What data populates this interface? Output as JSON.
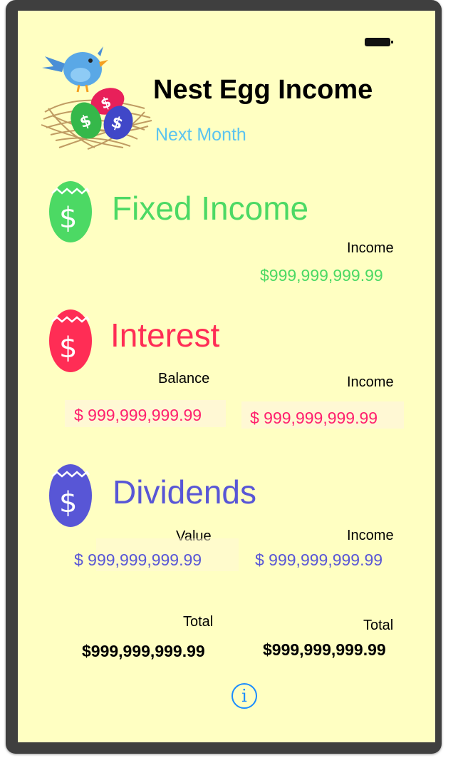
{
  "header": {
    "title": "Nest Egg Income",
    "subtitle": "Next Month"
  },
  "status_bar": {
    "battery_icon": "battery-icon"
  },
  "colors": {
    "screen_bg": "#ffffc2",
    "fixed_income": "#4cd964",
    "interest": "#ff2d55",
    "dividends": "#5856d6",
    "subtitle": "#5bc4f0",
    "info": "#1a8cff"
  },
  "fixed_income": {
    "title": "Fixed Income",
    "icon": "dollar-egg-icon",
    "income_label": "Income",
    "income_value": "$999,999,999.99"
  },
  "interest": {
    "title": "Interest",
    "icon": "dollar-egg-icon",
    "balance_label": "Balance",
    "balance_value": "$ 999,999,999.99",
    "income_label": "Income",
    "income_value": "$ 999,999,999.99"
  },
  "dividends": {
    "title": "Dividends",
    "icon": "dollar-egg-icon",
    "value_label": "Value",
    "value_value": "$ 999,999,999.99",
    "income_label": "Income",
    "income_value": "$ 999,999,999.99"
  },
  "totals": {
    "left_label": "Total",
    "left_value": "$999,999,999.99",
    "right_label": "Total",
    "right_value": "$999,999,999.99"
  },
  "info": {
    "glyph": "i",
    "icon": "info-icon"
  }
}
